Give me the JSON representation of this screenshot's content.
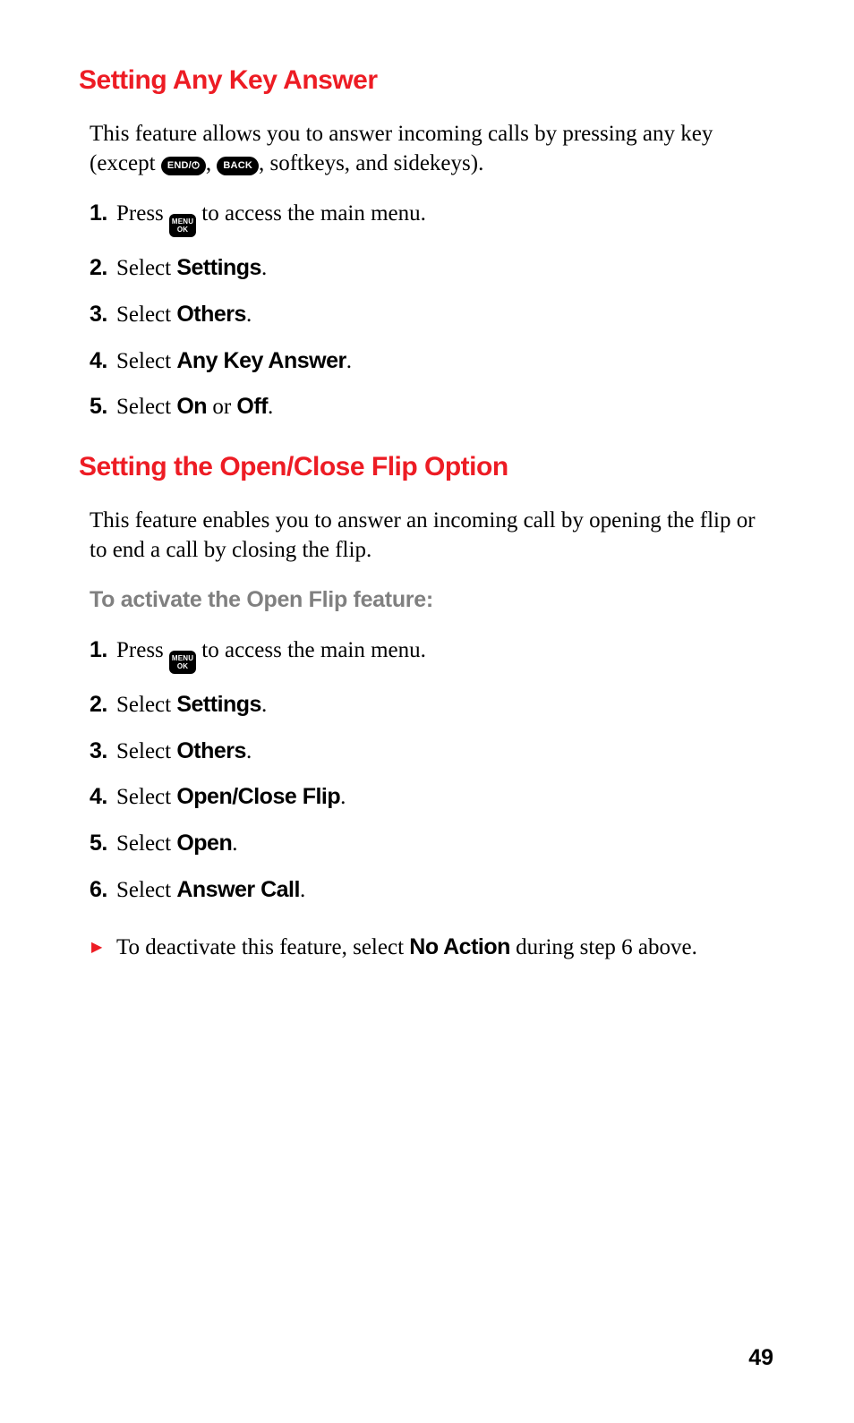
{
  "page_number": "49",
  "keys": {
    "end": "END/",
    "back": "BACK",
    "menu_l1": "MENU",
    "menu_l2": "OK"
  },
  "section1": {
    "heading": "Setting Any Key Answer",
    "intro_pre": "This feature allows you to answer incoming calls by pressing any key (except ",
    "intro_mid1": ", ",
    "intro_mid2": ", softkeys, and sidekeys).",
    "steps": {
      "n1": "1.",
      "s1a": "Press ",
      "s1b": " to access the main menu.",
      "n2": "2.",
      "s2a": "Select ",
      "s2b": "Settings",
      "s2c": ".",
      "n3": "3.",
      "s3a": "Select ",
      "s3b": "Others",
      "s3c": ".",
      "n4": "4.",
      "s4a": "Select ",
      "s4b": "Any Key Answer",
      "s4c": ".",
      "n5": "5.",
      "s5a": "Select ",
      "s5b": "On",
      "s5c": " or ",
      "s5d": "Off",
      "s5e": "."
    }
  },
  "section2": {
    "heading": "Setting the Open/Close Flip Option",
    "intro": "This feature enables you to answer an incoming call by opening the flip or to end a call by closing the flip.",
    "sub": "To activate the Open Flip feature:",
    "steps": {
      "n1": "1.",
      "s1a": "Press ",
      "s1b": " to access the main menu.",
      "n2": "2.",
      "s2a": "Select ",
      "s2b": "Settings",
      "s2c": ".",
      "n3": "3.",
      "s3a": "Select ",
      "s3b": "Others",
      "s3c": ".",
      "n4": "4.",
      "s4a": "Select ",
      "s4b": "Open/Close Flip",
      "s4c": ".",
      "n5": "5.",
      "s5a": "Select ",
      "s5b": "Open",
      "s5c": ".",
      "n6": "6.",
      "s6a": "Select ",
      "s6b": "Answer Call",
      "s6c": "."
    },
    "note_a": "To deactivate this feature, select ",
    "note_b": "No Action",
    "note_c": " during step 6 above."
  }
}
